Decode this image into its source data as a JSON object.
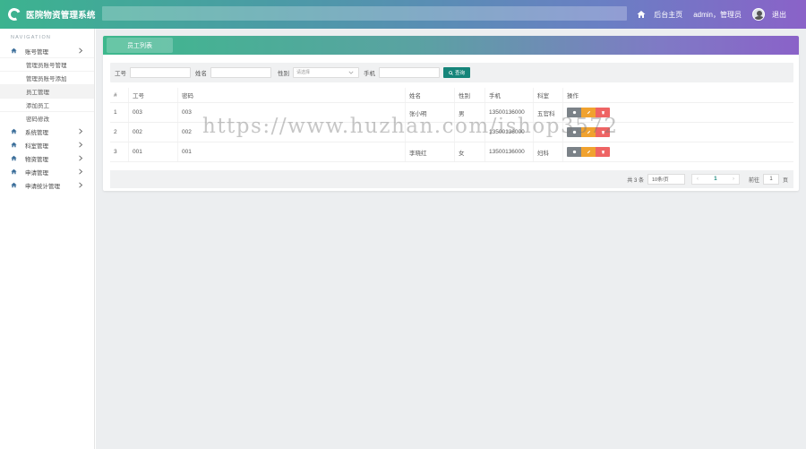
{
  "header": {
    "app_title": "医院物资管理系统",
    "home_label": "后台主页",
    "user_label": "admin，管理员",
    "logout_label": "退出"
  },
  "sidebar": {
    "heading": "NAVIGATION",
    "groups": [
      {
        "label": "账号管理",
        "expanded": true,
        "items": [
          "管理员账号管理",
          "管理员账号添加",
          "员工管理",
          "添加员工",
          "密码修改"
        ]
      },
      {
        "label": "系统管理"
      },
      {
        "label": "科室管理"
      },
      {
        "label": "物资管理"
      },
      {
        "label": "申请管理"
      },
      {
        "label": "申请统计管理"
      }
    ],
    "active_item": "员工管理"
  },
  "panel": {
    "tab_label": "员工列表"
  },
  "filter": {
    "label_id": "工号",
    "label_name": "姓名",
    "label_gender": "性别",
    "gender_placeholder": "请选择",
    "label_phone": "手机",
    "query_button": "查询"
  },
  "table": {
    "columns": [
      "#",
      "工号",
      "密码",
      "姓名",
      "性别",
      "手机",
      "科室",
      "操作"
    ],
    "rows": [
      [
        "1",
        "003",
        "003",
        "张小明",
        "男",
        "13500136000",
        "五官科"
      ],
      [
        "2",
        "002",
        "002",
        "",
        "",
        "13500136000",
        ""
      ],
      [
        "3",
        "001",
        "001",
        "李晓红",
        "女",
        "13500136000",
        "妇科"
      ]
    ]
  },
  "pagination": {
    "total": "共 3 条",
    "page_size": "10条/页",
    "prev": "‹",
    "current": "1",
    "next": "›",
    "goto_prefix": "前往",
    "goto_value": "1",
    "goto_suffix": "页"
  },
  "watermark": "https://www.huzhan.com/ishop3572",
  "colors": {
    "primary": "#16857a",
    "gradient_start": "#3cb38f",
    "gradient_end": "#8a62c8",
    "edit": "#f0a22f",
    "delete": "#ee6464",
    "view": "#7b8288"
  }
}
